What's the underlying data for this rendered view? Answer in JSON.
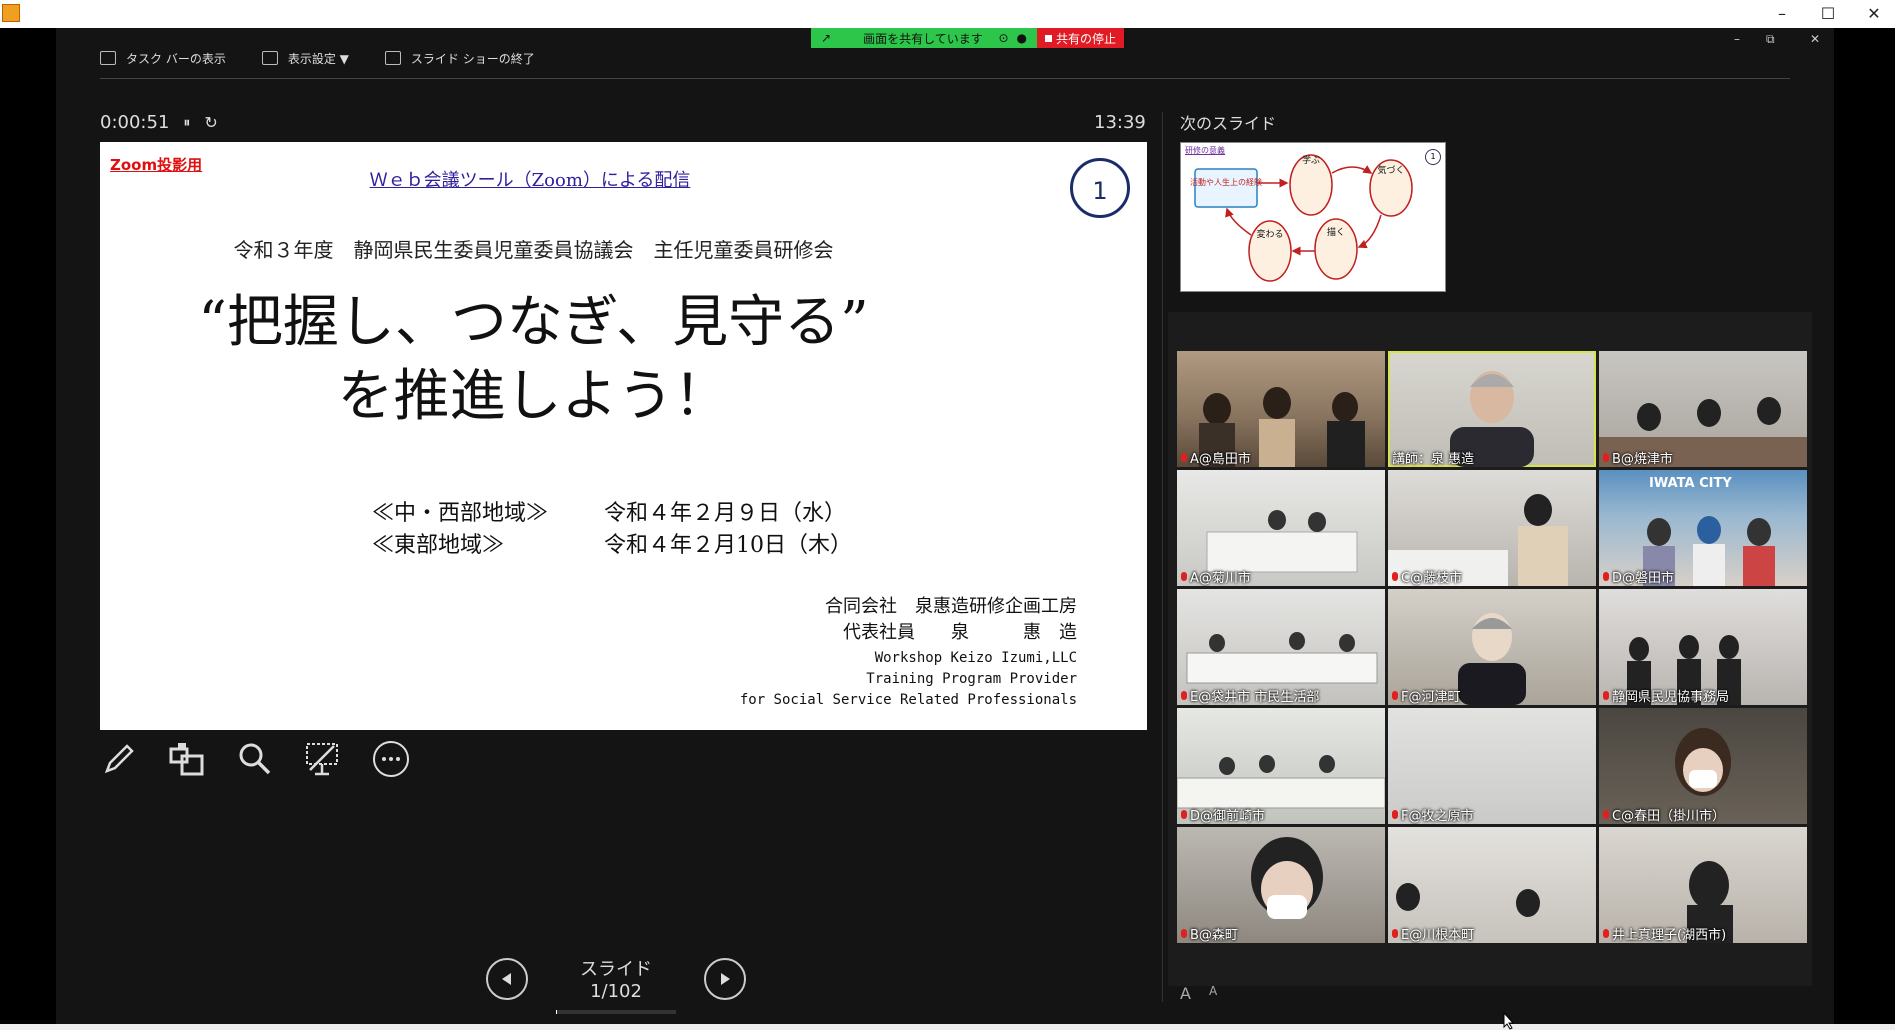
{
  "window": {
    "minimize": "–",
    "maximize": "☐",
    "close": "✕"
  },
  "toolbar": {
    "taskbar_label": "タスク バーの表示",
    "display_settings_label": "表示設定 ▼",
    "end_show_label": "スライド ショーの終了"
  },
  "share": {
    "status": "画面を共有しています",
    "stop": "共有の停止"
  },
  "mini": {
    "min": "–",
    "restore": "⧉",
    "close": "✕"
  },
  "timer": {
    "elapsed": "0:00:51",
    "pause": "⏸",
    "reset": "↻"
  },
  "clock": "13:39",
  "next_slide_label": "次のスライド",
  "slide": {
    "tag": "Zoom投影用",
    "subtitle": "Ｗｅｂ会議ツール（Zoom）による配信",
    "number": "1",
    "org": "令和３年度　静岡県民生委員児童委員協議会　主任児童委員研修会",
    "title_line1": "“把握し、つなぎ、見守る”",
    "title_line2": "を推進しよう！",
    "date1_region": "≪中・西部地域≫",
    "date1": "令和４年２月９日（水）",
    "date2_region": "≪東部地域≫",
    "date2": "令和４年２月10日（木）",
    "company": "合同会社　泉惠造研修企画工房",
    "rep": "代表社員　　泉　　　惠　造",
    "en1": "Workshop Keizo Izumi,LLC",
    "en2": "Training Program Provider",
    "en3": "for Social Service Related Professionals"
  },
  "preview": {
    "title": "研修の意義",
    "num": "1",
    "nodes": [
      "活動や人生上の経験",
      "学ぶ",
      "気づく",
      "描く",
      "変わる"
    ]
  },
  "nav": {
    "label": "スライド 1/102",
    "progress": 0.0098
  },
  "participants": [
    {
      "name": "A@島田市"
    },
    {
      "name": "講師：泉 惠造"
    },
    {
      "name": "B@焼津市"
    },
    {
      "name": "A@菊川市"
    },
    {
      "name": "C@藤枝市"
    },
    {
      "name": "D@磐田市"
    },
    {
      "name": "E@袋井市 市民生活部"
    },
    {
      "name": "F@河津町"
    },
    {
      "name": "静岡県民児協事務局"
    },
    {
      "name": "D@御前崎市"
    },
    {
      "name": "F@牧之原市"
    },
    {
      "name": "C@春田（掛川市）"
    },
    {
      "name": "B@森町"
    },
    {
      "name": "E@川根本町"
    },
    {
      "name": "井上真理子(湖西市)"
    }
  ],
  "iwata_sign": "IWATA CITY",
  "font_buttons": {
    "larger": "A",
    "smaller": "A"
  }
}
